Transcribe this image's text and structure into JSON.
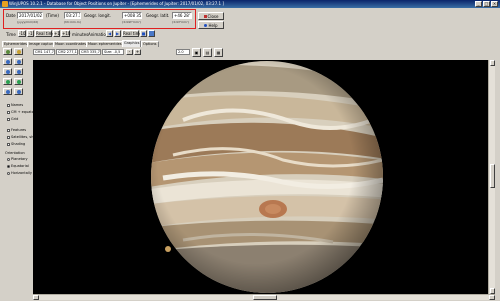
{
  "window": {
    "title": "WinJUPOS 10.2.1 - Database for Object Positions on Jupiter - [Ephemerides of Jupiter: 2017/01/02, 03:27.1 ]"
  },
  "fields": {
    "date_label": "Date",
    "date_value": "2017/01/02",
    "date_hint": "(yyyy/mm/dd)",
    "time_label": "(Time)",
    "time_value": "03:27.1",
    "time_hint": "(hh:mm.m)",
    "long_label": "Geogr. longit.",
    "long_value": "+008 35'",
    "long_hint": "(±ddd°mm')",
    "lat_label": "Geogr. latit.",
    "lat_value": "+46 28'",
    "lat_hint": "(±dd°mm')"
  },
  "buttons": {
    "close": "Close",
    "help": "Help"
  },
  "time_toolbar": {
    "time_label": "Time",
    "minus10": "-10",
    "minus1": "-1",
    "realtime": "Real time",
    "plus1": "+1",
    "plus10": "+10",
    "minutes_label": "minutes",
    "animation_label": "Animation",
    "real_time_2": "Real time"
  },
  "tabs": [
    "Ephemerides",
    "Image capture",
    "Moon coordinates",
    "Moon ephemerides",
    "Graphics",
    "Options"
  ],
  "coords": {
    "c1": "CM1 147,7°",
    "c2": "CM2 277,1°",
    "c3": "CM3 335,7°",
    "c4": "Size: -0,5",
    "zoom_value": "2.0"
  },
  "sidebar": {
    "names_label": "Names",
    "cm_label": "CM + equator",
    "grid_label": "Grid",
    "features_label": "Features",
    "sat_label": "Satellites, shad.",
    "shading_label": "Shading",
    "orientation_label": "Orientation",
    "opt1": "Planetary",
    "opt2": "Equatorial",
    "opt3": "Horizontally"
  },
  "colors": {
    "accent_red": "#e02020",
    "title_blue": "#0a246a",
    "stage_black": "#000000"
  }
}
